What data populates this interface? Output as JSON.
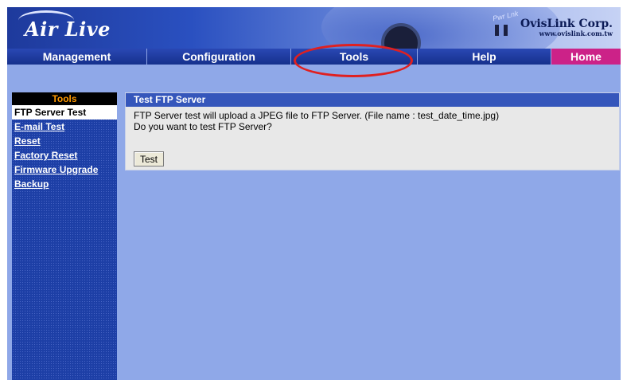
{
  "banner": {
    "logo": "Air Live",
    "indicator_label": "Pwr Lnk",
    "brand_name": "OvisLink Corp.",
    "brand_url": "www.ovislink.com.tw"
  },
  "nav": {
    "items": [
      {
        "label": "Management"
      },
      {
        "label": "Configuration"
      },
      {
        "label": "Tools"
      },
      {
        "label": "Help"
      },
      {
        "label": "Home"
      }
    ],
    "highlighted": "Tools",
    "highlight_color": "#e02020"
  },
  "sidebar": {
    "title": "Tools",
    "items": [
      {
        "label": "FTP Server Test",
        "active": true
      },
      {
        "label": "E-mail Test",
        "active": false
      },
      {
        "label": "Reset",
        "active": false
      },
      {
        "label": "Factory Reset",
        "active": false
      },
      {
        "label": "Firmware Upgrade",
        "active": false
      },
      {
        "label": "Backup",
        "active": false
      }
    ]
  },
  "content": {
    "header": "Test FTP Server",
    "line1": "FTP Server test will upload a JPEG file to FTP Server. (File name : test_date_time.jpg)",
    "line2": "Do you want to test FTP Server?",
    "button_label": "Test"
  },
  "colors": {
    "background": "#8fa8e8",
    "nav": "#1e3a9c",
    "home": "#cc2288",
    "sidebar_title_text": "#ff9900",
    "panel_header": "#3556bb"
  }
}
